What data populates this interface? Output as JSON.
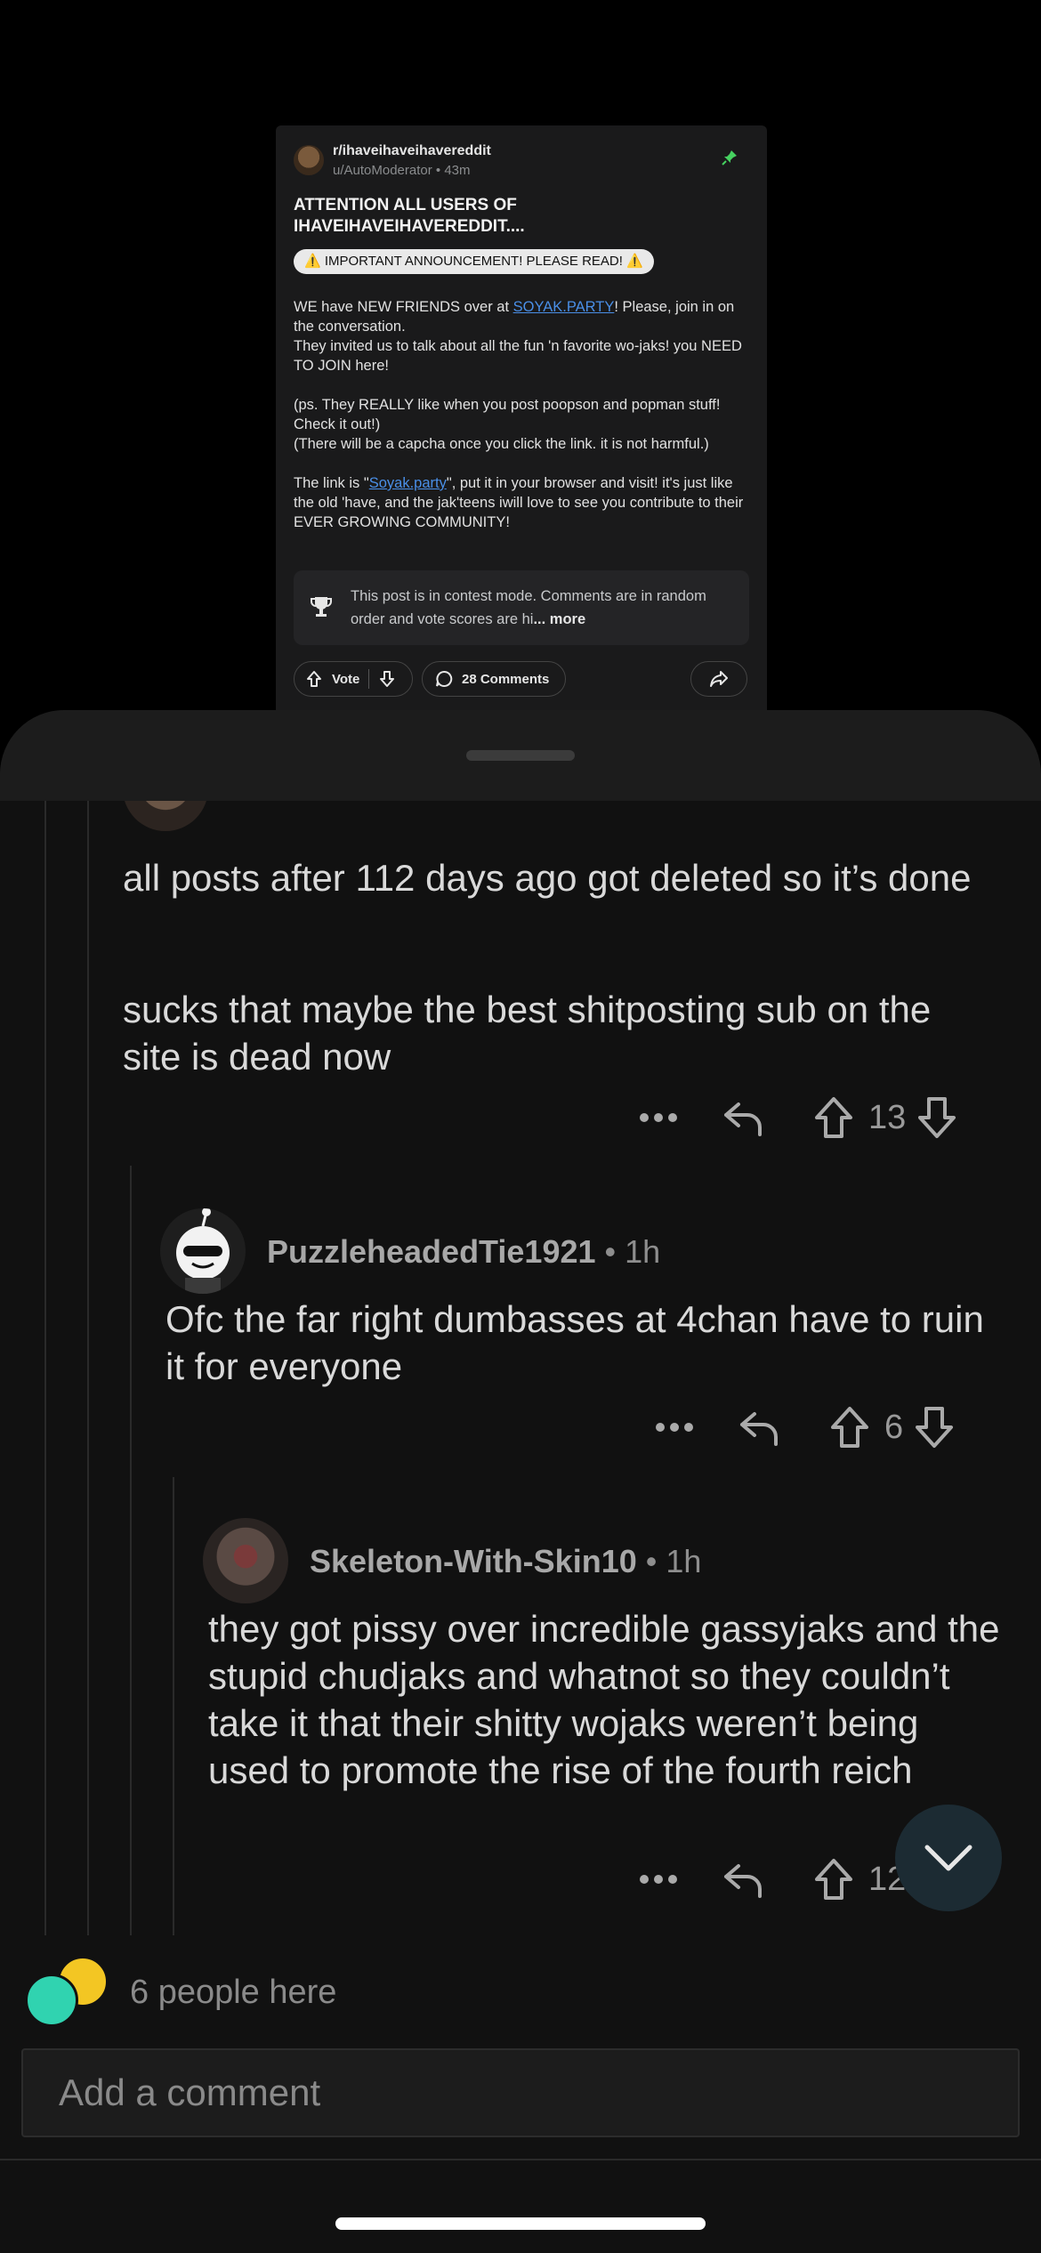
{
  "post": {
    "subreddit": "r/ihaveihaveihavereddit",
    "author": "u/AutoModerator",
    "time": "43m",
    "title": "ATTENTION ALL USERS OF IHAVEIHAVEIHAVEREDDIT....",
    "flair": "⚠️ IMPORTANT ANNOUNCEMENT! PLEASE READ! ⚠️",
    "para1_a": "WE have NEW FRIENDS over at ",
    "para1_link": "SOYAK.PARTY",
    "para1_b": "! Please, join in on the conversation.",
    "para1_c": "They invited us to talk about all the fun 'n favorite wo-jaks! you NEED TO JOIN here!",
    "para2_a": "(ps. They REALLY like when you post poopson and popman stuff! Check it out!)",
    "para2_b": "(There will be a capcha once you click the link. it is not harmful.)",
    "para3_a": "The link is \"",
    "para3_link": "Soyak.party",
    "para3_b": "\", put it in your browser and visit! it's just like the old 'have, and the jak'teens iwill love to see you contribute to their EVER GROWING COMMUNITY!",
    "contest_text": "This post is in contest mode. Comments are in random order and vote scores are hi",
    "contest_more": "... more",
    "vote_label": "Vote",
    "comments_label": "28 Comments"
  },
  "thread": {
    "comment1": {
      "line1": "all posts after 112 days ago got deleted so it’s done",
      "line2": "sucks that maybe the best shitposting sub on the site is dead now",
      "score": "13"
    },
    "comment2": {
      "author": "PuzzleheadedTie1921",
      "time": "1h",
      "text": "Ofc the far right dumbasses at 4chan have to ruin it for everyone",
      "score": "6"
    },
    "comment3": {
      "author": "Skeleton-With-Skin10",
      "time": "1h",
      "text": "they got pissy over incredible gassyjaks and the stupid chudjaks and whatnot so they couldn’t take it that their shitty wojaks weren’t being used to promote the rise of the fourth reich",
      "score": "12"
    }
  },
  "presence": {
    "label": "6 people here"
  },
  "composer": {
    "placeholder": "Add a comment"
  },
  "colors": {
    "background": "#000000",
    "sheet": "#111111",
    "link": "#4a8fe7",
    "pin": "#46d160",
    "fab": "#1c2b33"
  }
}
